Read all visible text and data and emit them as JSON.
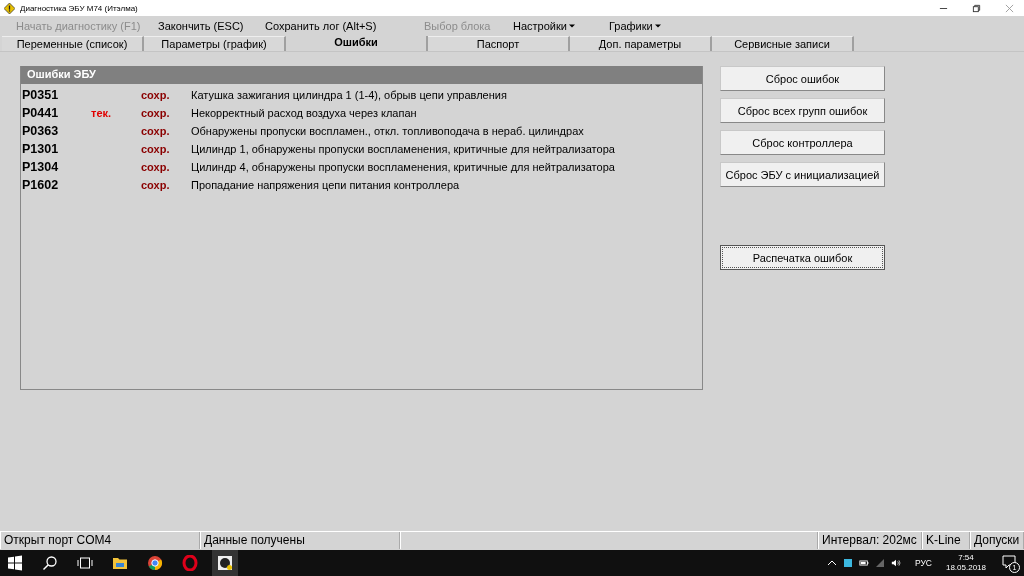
{
  "window": {
    "title": "Диагностика ЭБУ М74 (Итэлма)"
  },
  "menu": [
    {
      "label": "Начать диагностику (F1)",
      "disabled": true,
      "dropdown": false
    },
    {
      "label": "Закончить (ESC)",
      "disabled": false,
      "dropdown": false
    },
    {
      "label": "Сохранить лог (Alt+S)",
      "disabled": false,
      "dropdown": false
    },
    {
      "label": "Выбор блока",
      "disabled": true,
      "dropdown": false
    },
    {
      "label": "Настройки",
      "disabled": false,
      "dropdown": true
    },
    {
      "label": "Графики",
      "disabled": false,
      "dropdown": true
    }
  ],
  "tabs": [
    {
      "label": "Переменные (список)",
      "selected": false
    },
    {
      "label": "Параметры (график)",
      "selected": false
    },
    {
      "label": "Ошибки",
      "selected": true
    },
    {
      "label": "Паспорт",
      "selected": false
    },
    {
      "label": "Доп. параметры",
      "selected": false
    },
    {
      "label": "Сервисные записи",
      "selected": false
    }
  ],
  "errors_panel": {
    "title": "Ошибки ЭБУ",
    "rows": [
      {
        "code": "P0351",
        "stored": "сохр.",
        "description": "Катушка зажигания цилиндра 1 (1-4), обрыв цепи управления"
      },
      {
        "code": "P0441",
        "current": "тек.",
        "stored": "сохр.",
        "description": "Некорректный расход воздуха через клапан"
      },
      {
        "code": "P0363",
        "stored": "сохр.",
        "description": "Обнаружены пропуски воспламен., откл. топливоподача в нераб. цилиндрах"
      },
      {
        "code": "P1301",
        "stored": "сохр.",
        "description": "Цилиндр 1, обнаружены пропуски воспламенения, критичные для нейтрализатора"
      },
      {
        "code": "P1304",
        "stored": "сохр.",
        "description": "Цилиндр 4, обнаружены пропуски воспламенения, критичные для нейтрализатора"
      },
      {
        "code": "P1602",
        "stored": "сохр.",
        "description": "Пропадание напряжения цепи питания контроллера"
      }
    ]
  },
  "buttons": [
    {
      "label": "Сброс ошибок",
      "focused": false
    },
    {
      "label": "Сброс всех групп ошибок",
      "focused": false
    },
    {
      "label": "Сброс контроллера",
      "focused": false
    },
    {
      "label": "Сброс ЭБУ с инициализацией",
      "focused": false
    }
  ],
  "print_button": {
    "label": "Распечатка ошибок",
    "focused": true
  },
  "status_bar": [
    "Открыт порт COM4",
    "Данные получены",
    "Интервал: 202мс",
    "K-Line",
    "Допуски"
  ],
  "taskbar": {
    "language": "РУС",
    "time": "7:54",
    "date": "18.05.2018",
    "notification_count": "1"
  }
}
